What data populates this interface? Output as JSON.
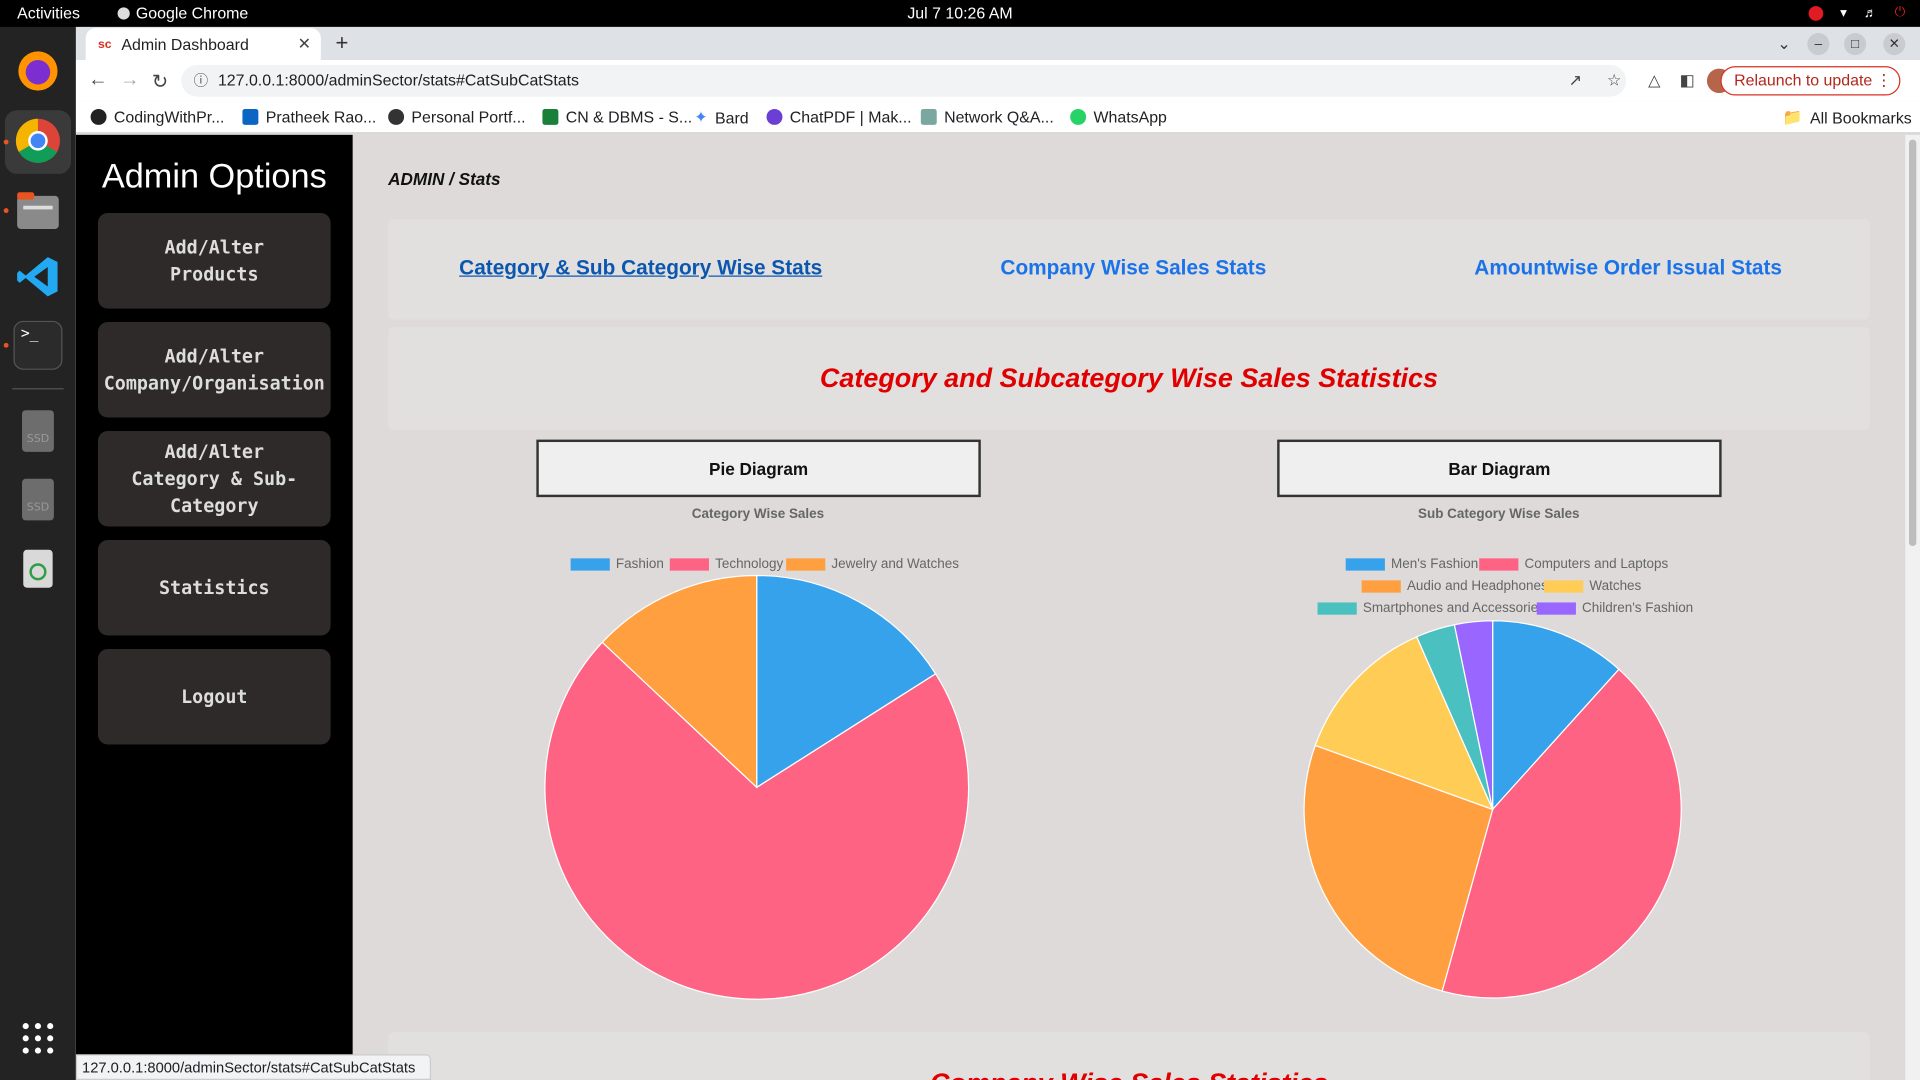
{
  "os": {
    "activities": "Activities",
    "app_name": "Google Chrome",
    "clock": "Jul 7  10:26 AM"
  },
  "browser": {
    "tab_title": "Admin Dashboard",
    "url": "127.0.0.1:8000/adminSector/stats#CatSubCatStats",
    "relaunch_label": "Relaunch to update",
    "bookmarks": [
      "CodingWithPr...",
      "Pratheek Rao...",
      "Personal Portf...",
      "CN & DBMS - S...",
      "Bard",
      "ChatPDF | Mak...",
      "Network Q&A...",
      "WhatsApp"
    ],
    "all_bookmarks": "All Bookmarks",
    "status_url": "127.0.0.1:8000/adminSector/stats#CatSubCatStats"
  },
  "sidebar": {
    "title": "Admin Options",
    "items": [
      {
        "label": "Add/Alter\nProducts"
      },
      {
        "label": "Add/Alter\nCompany/Organisation"
      },
      {
        "label": "Add/Alter\nCategory & Sub-\nCategory"
      },
      {
        "label": "Statistics"
      },
      {
        "label": "Logout"
      }
    ]
  },
  "main": {
    "breadcrumb": "ADMIN / Stats",
    "links": [
      "Category & Sub Category Wise Stats",
      "Company Wise Sales Stats",
      "Amountwise Order Issual Stats"
    ],
    "section_title": "Category and Subcategory Wise Sales Statistics",
    "pie_button": "Pie Diagram",
    "bar_button": "Bar Diagram",
    "next_section_title": "Company Wise Sales Statistics"
  },
  "colors": {
    "blue": "#36a2eb",
    "red": "#ff6384",
    "orange": "#ff9f40",
    "yellow": "#ffcd56",
    "teal": "#4bc0c0",
    "purple": "#9966ff"
  },
  "chart_data": [
    {
      "type": "pie",
      "title": "Category Wise Sales",
      "legend_position": "top",
      "categories": [
        "Fashion",
        "Technology",
        "Jewelry and Watches"
      ],
      "values": [
        16,
        71,
        13
      ],
      "colors": [
        "#36a2eb",
        "#ff6384",
        "#ff9f40"
      ]
    },
    {
      "type": "pie",
      "title": "Sub Category Wise Sales",
      "legend_position": "top",
      "categories": [
        "Men's Fashion",
        "Computers and Laptops",
        "Audio and Headphones",
        "Watches",
        "Smartphones and Accessories",
        "Children's Fashion"
      ],
      "values": [
        11.5,
        42,
        25.8,
        12.7,
        3.3,
        3.2
      ],
      "colors": [
        "#36a2eb",
        "#ff6384",
        "#ff9f40",
        "#ffcd56",
        "#4bc0c0",
        "#9966ff"
      ]
    }
  ]
}
